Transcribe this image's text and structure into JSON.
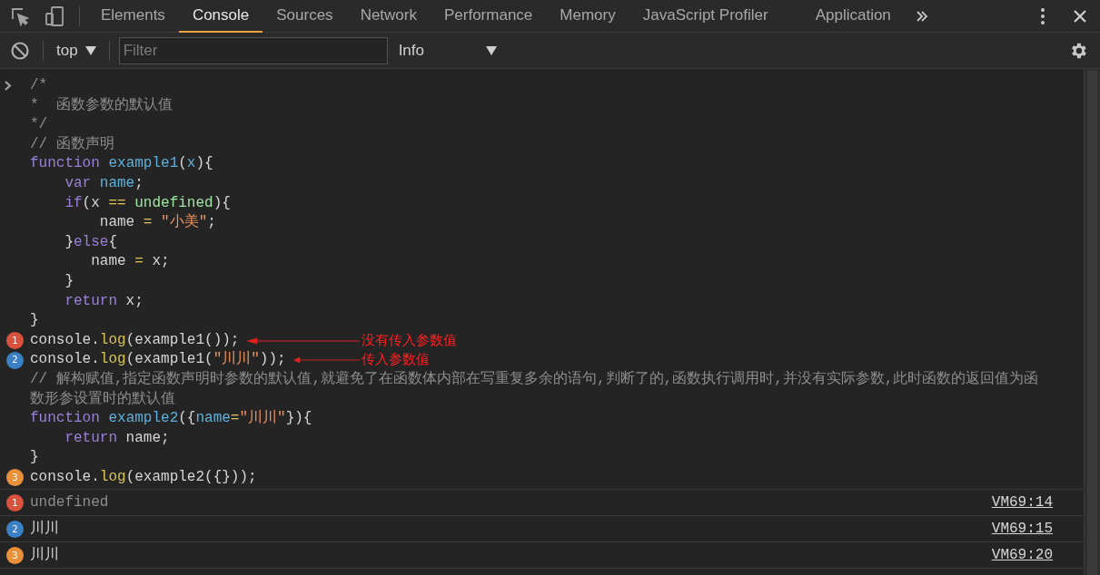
{
  "tabs": [
    {
      "label": "Elements",
      "selected": false
    },
    {
      "label": "Console",
      "selected": true
    },
    {
      "label": "Sources",
      "selected": false
    },
    {
      "label": "Network",
      "selected": false
    },
    {
      "label": "Performance",
      "selected": false
    },
    {
      "label": "Memory",
      "selected": false
    },
    {
      "label": "JavaScript Profiler",
      "selected": false
    },
    {
      "label": "Application",
      "selected": false
    }
  ],
  "console_toolbar": {
    "context": "top",
    "filter": {
      "placeholder": "Filter"
    },
    "level": "Info"
  },
  "input_lines": [
    {
      "tokens": [
        {
          "kind": "comment",
          "text": "/*"
        }
      ]
    },
    {
      "tokens": [
        {
          "kind": "comment",
          "text": "*  函数参数的默认值"
        }
      ]
    },
    {
      "tokens": [
        {
          "kind": "comment",
          "text": "*/"
        }
      ]
    },
    {
      "tokens": [
        {
          "kind": "comment",
          "text": "// 函数声明"
        }
      ]
    },
    {
      "tokens": [
        {
          "kind": "keyword",
          "text": "function "
        },
        {
          "kind": "name",
          "text": "example1"
        },
        {
          "kind": "plain",
          "text": "("
        },
        {
          "kind": "name",
          "text": "x"
        },
        {
          "kind": "plain",
          "text": "){"
        }
      ]
    },
    {
      "tokens": [
        {
          "kind": "keyword",
          "text": "    var "
        },
        {
          "kind": "name",
          "text": "name"
        },
        {
          "kind": "plain",
          "text": ";"
        }
      ]
    },
    {
      "tokens": [
        {
          "kind": "keyword",
          "text": "    if"
        },
        {
          "kind": "plain",
          "text": "(x "
        },
        {
          "kind": "operator",
          "text": "== "
        },
        {
          "kind": "literal",
          "text": "undefined"
        },
        {
          "kind": "plain",
          "text": "){"
        }
      ]
    },
    {
      "tokens": [
        {
          "kind": "plain",
          "text": "        name "
        },
        {
          "kind": "operator",
          "text": "= "
        },
        {
          "kind": "string",
          "text": "\"小美\""
        },
        {
          "kind": "plain",
          "text": ";"
        }
      ]
    },
    {
      "tokens": [
        {
          "kind": "plain",
          "text": "    }"
        },
        {
          "kind": "keyword",
          "text": "else"
        },
        {
          "kind": "plain",
          "text": "{"
        }
      ]
    },
    {
      "tokens": [
        {
          "kind": "plain",
          "text": "       name "
        },
        {
          "kind": "operator",
          "text": "="
        },
        {
          "kind": "plain",
          "text": " x;"
        }
      ]
    },
    {
      "tokens": [
        {
          "kind": "plain",
          "text": "    }"
        }
      ]
    },
    {
      "tokens": [
        {
          "kind": "keyword",
          "text": "    return"
        },
        {
          "kind": "plain",
          "text": " x;"
        }
      ]
    },
    {
      "tokens": [
        {
          "kind": "plain",
          "text": "}"
        }
      ]
    },
    {
      "badge": "1",
      "color": "#d9533c",
      "tokens": [
        {
          "kind": "plain",
          "text": "console."
        },
        {
          "kind": "method",
          "text": "log"
        },
        {
          "kind": "plain",
          "text": "(example1());"
        }
      ],
      "annotation": "没有传入参数值"
    },
    {
      "badge": "2",
      "color": "#3b7fc4",
      "tokens": [
        {
          "kind": "plain",
          "text": "console."
        },
        {
          "kind": "method",
          "text": "log"
        },
        {
          "kind": "plain",
          "text": "(example1("
        },
        {
          "kind": "string",
          "text": "\"川川\""
        },
        {
          "kind": "plain",
          "text": "));"
        }
      ],
      "annotation": "传入参数值"
    },
    {
      "tokens": [
        {
          "kind": "comment",
          "text": "// 解构赋值,指定函数声明时参数的默认值,就避免了在函数体内部在写重复多余的语句,判断了的,函数执行调用时,并没有实际参数,此时函数的返回值为函数形参设置时的默认值"
        }
      ]
    },
    {
      "tokens": [
        {
          "kind": "keyword",
          "text": "function "
        },
        {
          "kind": "name",
          "text": "example2"
        },
        {
          "kind": "plain",
          "text": "({"
        },
        {
          "kind": "name",
          "text": "name"
        },
        {
          "kind": "operator",
          "text": "="
        },
        {
          "kind": "string",
          "text": "\"川川\""
        },
        {
          "kind": "plain",
          "text": "}){"
        }
      ]
    },
    {
      "tokens": [
        {
          "kind": "keyword",
          "text": "    return"
        },
        {
          "kind": "plain",
          "text": " name;"
        }
      ]
    },
    {
      "tokens": [
        {
          "kind": "plain",
          "text": "}"
        }
      ]
    },
    {
      "badge": "3",
      "color": "#e8903a",
      "tokens": [
        {
          "kind": "plain",
          "text": "console."
        },
        {
          "kind": "method",
          "text": "log"
        },
        {
          "kind": "plain",
          "text": "(example2({}));"
        }
      ]
    }
  ],
  "outputs": [
    {
      "badge": "1",
      "color": "#d9533c",
      "kind": "undefined",
      "text": "undefined",
      "source": "VM69:14"
    },
    {
      "badge": "2",
      "color": "#3b7fc4",
      "kind": "string",
      "text": "川川",
      "source": "VM69:15"
    },
    {
      "badge": "3",
      "color": "#e8903a",
      "kind": "string",
      "text": "川川",
      "source": "VM69:20"
    }
  ]
}
